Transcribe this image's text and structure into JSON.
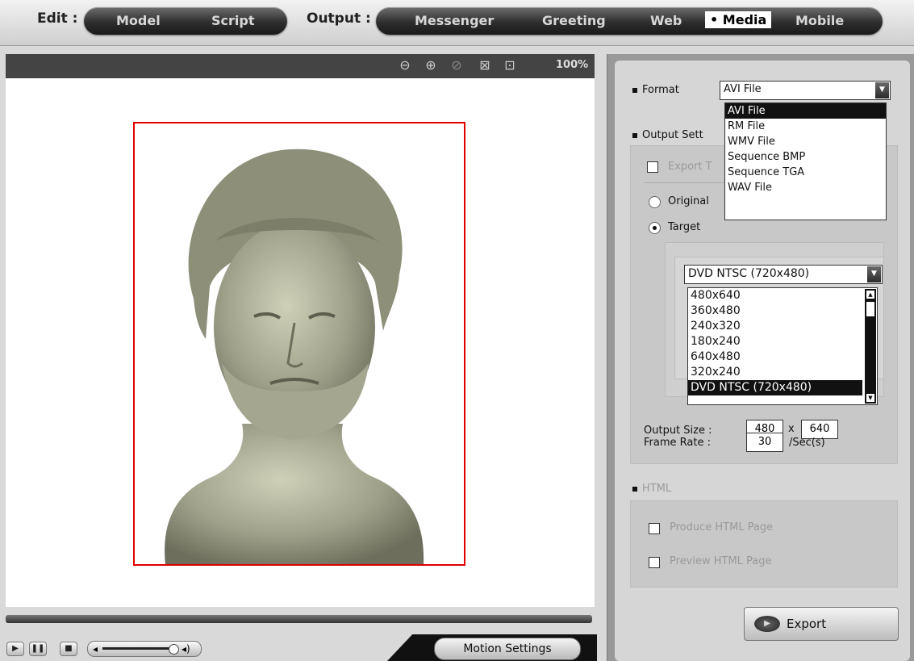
{
  "topbar": {
    "edit_label": "Edit :",
    "edit_tabs": [
      "Model",
      "Script"
    ],
    "output_label": "Output :",
    "output_tabs": [
      "Messenger",
      "Greeting",
      "Web",
      "• Media",
      "Mobile"
    ]
  },
  "viewer": {
    "zoom": "100%"
  },
  "motion_button": "Motion Settings",
  "right": {
    "format_label": "Format",
    "format_value": "AVI File",
    "format_options": [
      "AVI File",
      "RM File",
      "WMV File",
      "Sequence BMP",
      "Sequence TGA",
      "WAV File"
    ],
    "output_settings_label": "Output Sett",
    "export_partial": "Export T",
    "original_label": "Original",
    "target_label": "Target",
    "size_value": "DVD NTSC (720x480)",
    "size_options": [
      "480x640",
      "360x480",
      "240x320",
      "180x240",
      "640x480",
      "320x240",
      "DVD NTSC (720x480)"
    ],
    "output_size_label": "Output Size :",
    "output_w": "480",
    "output_x": "x",
    "output_h": "640",
    "frame_rate_label": "Frame Rate :",
    "frame_rate_value": "30",
    "frame_rate_unit": "/Sec(s)",
    "html_label": "HTML",
    "produce_html": "Produce HTML Page",
    "preview_html": "Preview HTML Page",
    "export_button": "Export"
  },
  "colors": {
    "frame_border": "#e00000",
    "selected_bg": "#111111"
  }
}
